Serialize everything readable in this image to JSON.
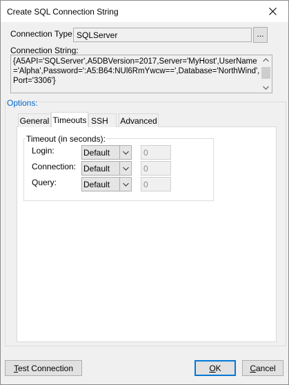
{
  "window": {
    "title": "Create SQL Connection String"
  },
  "connection_type": {
    "label": "Connection Type:",
    "value": "SQLServer",
    "browse_label": "..."
  },
  "connection_string": {
    "label": "Connection String:",
    "value": "{A5API='SQLServer',A5DBVersion=2017,Server='MyHost',UserName='Alpha',Password=':A5:B64:NUl6RmYwcw==',Database='NorthWind',Port='3306'}"
  },
  "options": {
    "label": "Options:",
    "tabs": [
      {
        "label": "General"
      },
      {
        "label": "Timeouts"
      },
      {
        "label": "SSH"
      },
      {
        "label": "Advanced"
      }
    ],
    "active_tab": "Timeouts"
  },
  "timeouts": {
    "group_label": "Timeout (in seconds):",
    "rows": [
      {
        "label": "Login:",
        "mode": "Default",
        "value": "0"
      },
      {
        "label": "Connection:",
        "mode": "Default",
        "value": "0"
      },
      {
        "label": "Query:",
        "mode": "Default",
        "value": "0"
      }
    ]
  },
  "buttons": {
    "test_prefix": "T",
    "test_rest": "est Connection",
    "ok_prefix": "O",
    "ok_rest": "K",
    "cancel_prefix": "C",
    "cancel_rest": "ancel"
  },
  "icons": {
    "close": "close-icon",
    "scroll_up": "chevron-up-icon",
    "scroll_down": "chevron-down-icon",
    "dropdown": "chevron-down-icon"
  }
}
